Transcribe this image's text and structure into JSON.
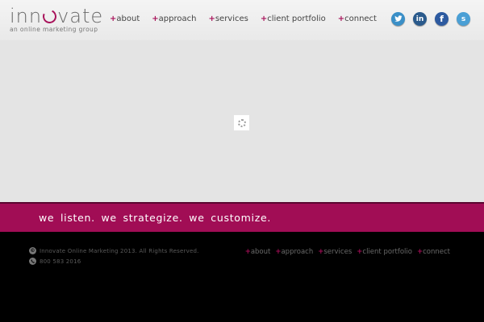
{
  "brand": {
    "name": "innovate",
    "tagline": "an online marketing group"
  },
  "nav": [
    {
      "label": "about"
    },
    {
      "label": "approach"
    },
    {
      "label": "services"
    },
    {
      "label": "client portfolio"
    },
    {
      "label": "connect"
    }
  ],
  "social": [
    {
      "icon": "twitter-icon",
      "glyph": "t"
    },
    {
      "icon": "linkedin-icon",
      "glyph": "in"
    },
    {
      "icon": "facebook-icon",
      "glyph": "f"
    },
    {
      "icon": "skype-icon",
      "glyph": "s"
    }
  ],
  "banner": {
    "text": "we listen.  we strategize.  we customize."
  },
  "footer": {
    "copyright": "Innovate Online Marketing 2013. All Rights Reserved.",
    "phone": "800 583 2016",
    "nav": [
      {
        "label": "about"
      },
      {
        "label": "approach"
      },
      {
        "label": "services"
      },
      {
        "label": "client portfolio"
      },
      {
        "label": "connect"
      }
    ]
  },
  "colors": {
    "accent": "#a10d55",
    "header_bg": "#eeeeee",
    "main_bg": "#e4e4e4",
    "footer_bg": "#000000"
  }
}
